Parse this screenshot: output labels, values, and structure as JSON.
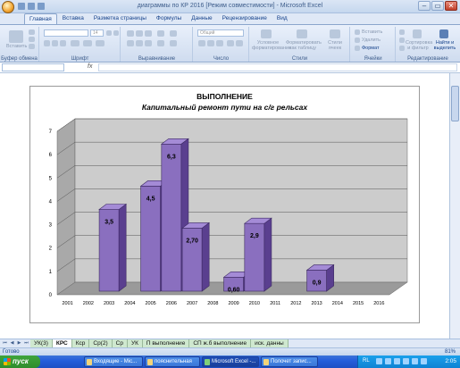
{
  "window": {
    "title": "диаграммы по КР 2016  [Режим совместимости] - Microsoft Excel",
    "controls": [
      "‒",
      "▭",
      "✕"
    ]
  },
  "ribbon_tabs": [
    "Главная",
    "Вставка",
    "Разметка страницы",
    "Формулы",
    "Данные",
    "Рецензирование",
    "Вид"
  ],
  "ribbon": {
    "clipboard": {
      "label": "Буфер обмена",
      "paste": "Вставить"
    },
    "font": {
      "label": "Шрифт",
      "size": "14"
    },
    "alignment": {
      "label": "Выравнивание"
    },
    "number": {
      "label": "Число",
      "format": "Общий"
    },
    "styles": {
      "label": "Стили",
      "conditional": "Условное форматирование",
      "table": "Форматировать как таблицу",
      "cell_styles": "Стили ячеек"
    },
    "cells": {
      "label": "Ячейки",
      "insert": "Вставить",
      "delete": "Удалить",
      "format": "Формат"
    },
    "editing": {
      "label": "Редактирование",
      "sort": "Сортировка и фильтр",
      "find": "Найти и выделить"
    }
  },
  "formula_bar": {
    "fx": "fx",
    "value": ""
  },
  "chart_data": {
    "type": "bar",
    "title": "ВЫПОЛНЕНИЕ",
    "subtitle": "Капитальный ремонт пути на с/г рельсах",
    "categories": [
      "2001",
      "2002",
      "2003",
      "2004",
      "2005",
      "2006",
      "2007",
      "2008",
      "2009",
      "2010",
      "2011",
      "2012",
      "2013",
      "2014",
      "2015",
      "2016"
    ],
    "series": [
      {
        "values": [
          null,
          null,
          3.5,
          null,
          4.5,
          6.3,
          2.7,
          null,
          0.6,
          2.9,
          null,
          null,
          0.9,
          null,
          null,
          null
        ],
        "labels": [
          "",
          "",
          "3,5",
          "",
          "4,5",
          "6,3",
          "2,70",
          "",
          "0,60",
          "2,9",
          "",
          "",
          "0,9",
          "",
          "",
          ""
        ],
        "color": "#8a6fbf"
      }
    ],
    "ylim": [
      0,
      7
    ],
    "yticks": [
      "0",
      "1",
      "2",
      "3",
      "4",
      "5",
      "6",
      "7"
    ],
    "grid": true,
    "style": "3d-column"
  },
  "sheet_tabs": [
    "УК(3)",
    "КРС",
    "Кср",
    "Ср(2)",
    "Ср",
    "УК",
    "П выполнение",
    "СП ж.б выполнение",
    "иск. данны"
  ],
  "active_sheet": "КРС",
  "status": {
    "text": "Готово",
    "zoom": "81%"
  },
  "taskbar": {
    "start": "пуск",
    "items": [
      "Входящие - Mic...",
      "пояснительная",
      "Microsoft Excel -...",
      "Полочет запис..."
    ],
    "lang": "RL",
    "clock": "2:05"
  }
}
